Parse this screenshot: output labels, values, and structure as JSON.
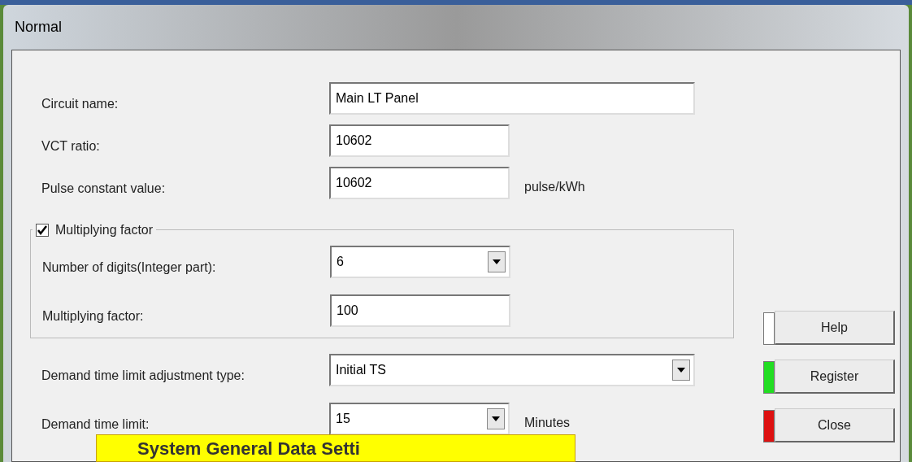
{
  "window": {
    "title": "Normal"
  },
  "fields": [
    {
      "label": "Circuit name:",
      "value": "Main LT Panel",
      "kind": "text"
    },
    {
      "label": "VCT ratio:",
      "value": "10602",
      "kind": "text"
    },
    {
      "label": "Pulse constant value:",
      "value": "10602",
      "kind": "text",
      "unit": "pulse/kWh"
    }
  ],
  "group": {
    "label": "Multiplying factor",
    "checked": true,
    "fields": [
      {
        "label": "Number of digits(Integer part):",
        "value": "6",
        "kind": "combo"
      },
      {
        "label": "Multiplying factor:",
        "value": "100",
        "kind": "text"
      }
    ]
  },
  "demand_fields": [
    {
      "label": "Demand time limit adjustment type:",
      "value": "Initial TS",
      "kind": "combo"
    },
    {
      "label": "Demand time limit:",
      "value": "15",
      "kind": "combo",
      "unit": "Minutes"
    }
  ],
  "buttons": [
    {
      "label": "Help",
      "color": "#ffffff"
    },
    {
      "label": "Register",
      "color": "#22dd22"
    },
    {
      "label": "Close",
      "color": "#dd1111"
    }
  ],
  "caption": "System General Data Setti"
}
